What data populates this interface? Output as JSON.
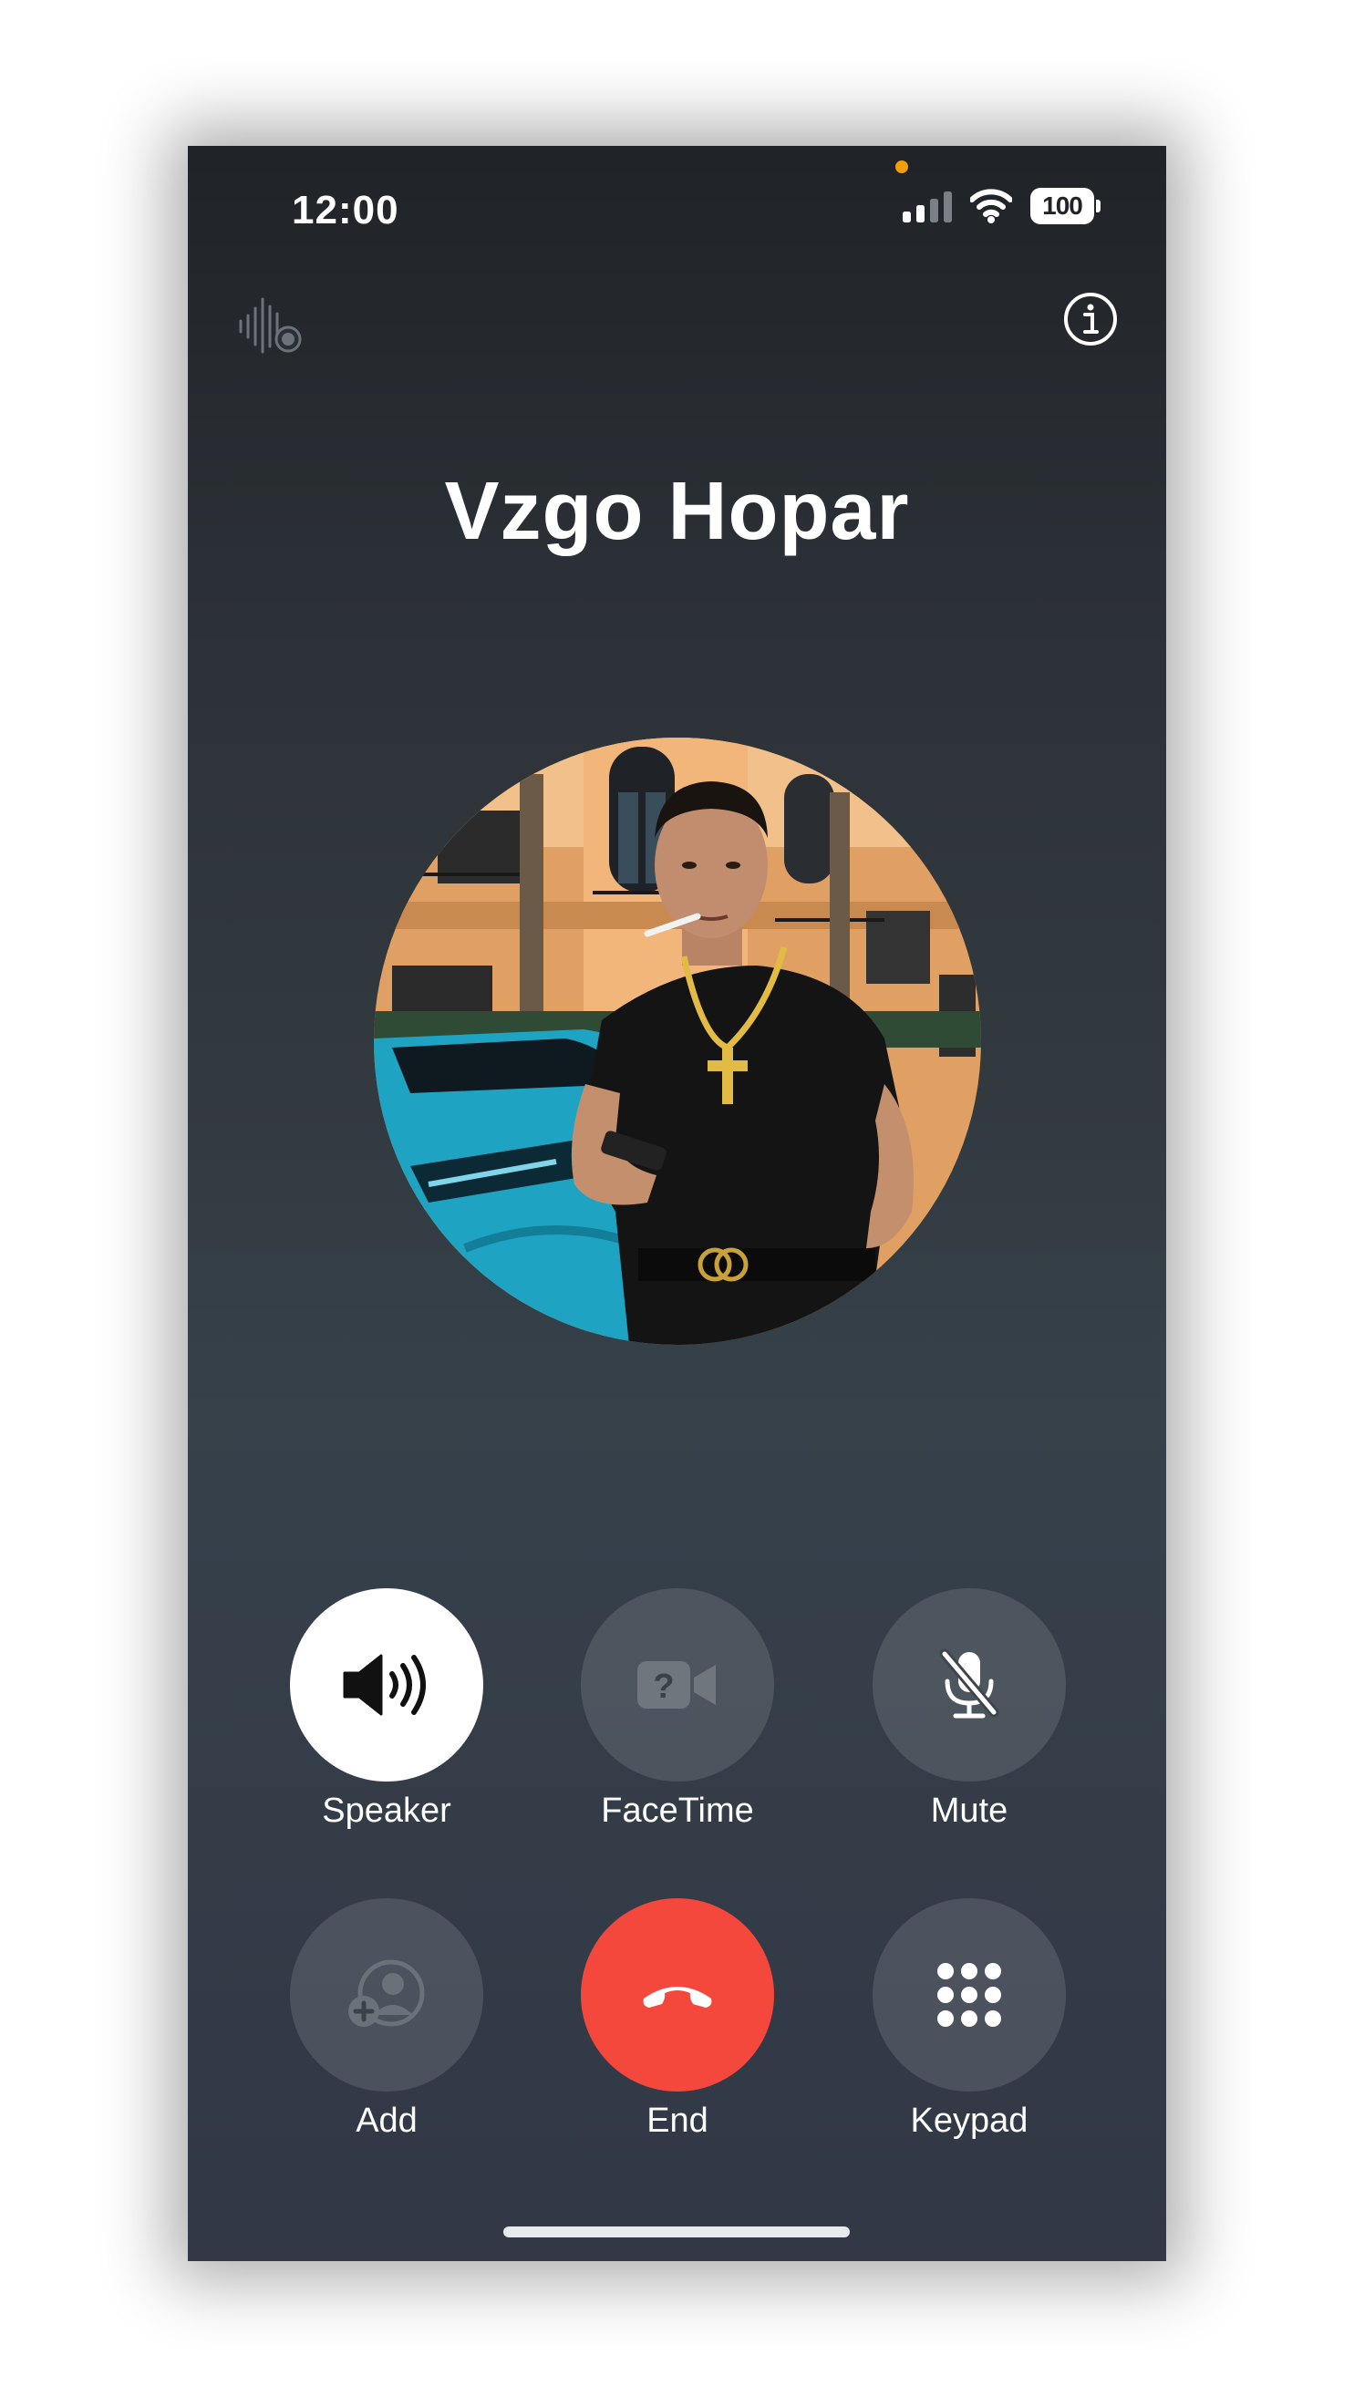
{
  "status_bar": {
    "time": "12:00",
    "battery": "100"
  },
  "caller": {
    "name": "Vzgo Hopar"
  },
  "controls": {
    "speaker": "Speaker",
    "facetime": "FaceTime",
    "mute": "Mute",
    "add": "Add",
    "end": "End",
    "keypad": "Keypad"
  },
  "icons": {
    "top_left": "live-audio-waveform-icon",
    "top_right": "info-icon",
    "speaker": "speaker-wave-icon",
    "facetime": "video-camera-question-icon",
    "mute": "microphone-slash-icon",
    "add": "person-add-icon",
    "end": "phone-hangup-icon",
    "keypad": "keypad-grid-icon"
  },
  "colors": {
    "end_button": "#f3483b",
    "active_button": "#ffffff",
    "inactive_button": "rgba(255,255,255,0.12)",
    "recording_dot": "#f59e0b"
  }
}
